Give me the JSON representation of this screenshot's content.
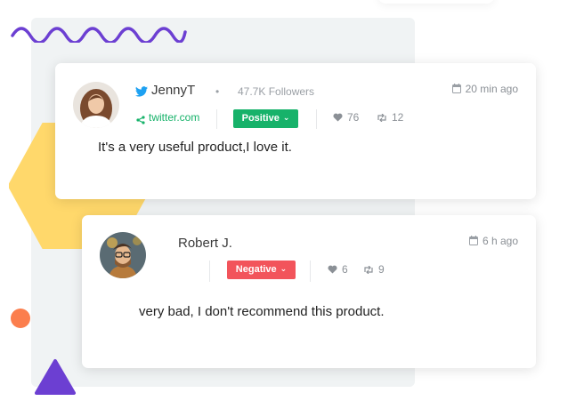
{
  "colors": {
    "accent_green": "#17b26a",
    "negative_red": "#f2545b",
    "twitter_blue": "#1da1f2",
    "wave_purple": "#6c3fd2",
    "hexagon_yellow": "#ffd86b",
    "dot_orange": "#fb7e4d"
  },
  "reviews": [
    {
      "author": "JennyT",
      "source_icon": "twitter-icon",
      "followers": "47.7K Followers",
      "link": "twitter.com",
      "sentiment": "Positive",
      "likes": "76",
      "retweets": "12",
      "time": "20 min ago",
      "message": "It's a very useful product,I love it."
    },
    {
      "author": "Robert J.",
      "sentiment": "Negative",
      "likes": "6",
      "retweets": "9",
      "time": "6 h ago",
      "message": "very bad, I don't recommend this product."
    }
  ]
}
